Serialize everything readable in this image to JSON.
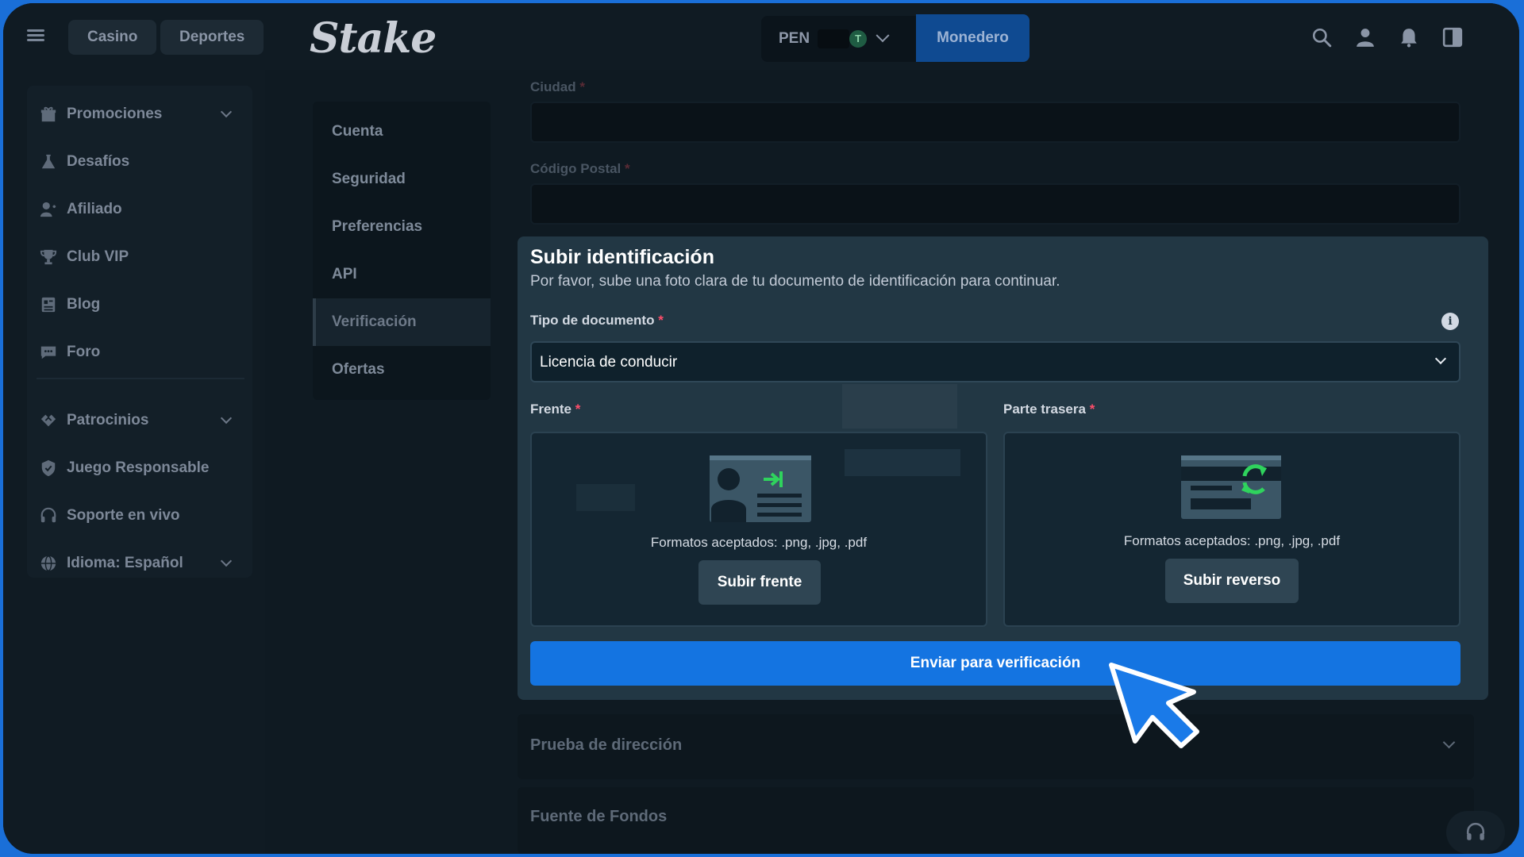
{
  "topbar": {
    "tabs": [
      "Casino",
      "Deportes"
    ],
    "logo": "Stake",
    "currency": "PEN",
    "currency_badge": "T",
    "wallet_label": "Monedero",
    "icons": [
      "search-icon",
      "user-icon",
      "bell-icon",
      "sidebar-toggle-icon"
    ]
  },
  "sidebar": {
    "items": [
      {
        "label": "Promociones",
        "icon": "gift-icon",
        "expandable": true
      },
      {
        "label": "Desafíos",
        "icon": "flask-icon",
        "expandable": false
      },
      {
        "label": "Afiliado",
        "icon": "affiliate-icon",
        "expandable": false
      },
      {
        "label": "Club VIP",
        "icon": "trophy-icon",
        "expandable": false
      },
      {
        "label": "Blog",
        "icon": "blog-icon",
        "expandable": false
      },
      {
        "label": "Foro",
        "icon": "forum-icon",
        "expandable": false
      },
      {
        "label": "Patrocinios",
        "icon": "handshake-icon",
        "expandable": true
      },
      {
        "label": "Juego Responsable",
        "icon": "shield-icon",
        "expandable": false
      },
      {
        "label": "Soporte en vivo",
        "icon": "headset-icon",
        "expandable": false
      },
      {
        "label": "Idioma: Español",
        "icon": "globe-icon",
        "expandable": true
      }
    ]
  },
  "settings_nav": {
    "items": [
      "Cuenta",
      "Seguridad",
      "Preferencias",
      "API",
      "Verificación",
      "Ofertas"
    ],
    "active": "Verificación"
  },
  "background_form": {
    "city_label": "Ciudad",
    "postal_label": "Código Postal",
    "required_mark": "*",
    "sections": [
      "Prueba de dirección",
      "Fuente de Fondos"
    ]
  },
  "modal": {
    "title": "Subir identificación",
    "subtitle": "Por favor, sube una foto clara de tu documento de identificación para continuar.",
    "doc_type_label": "Tipo de documento",
    "doc_type_value": "Licencia de conducir",
    "required_mark": "*",
    "front": {
      "label": "Frente",
      "formats": "Formatos aceptados: .png, .jpg, .pdf",
      "button": "Subir frente"
    },
    "back": {
      "label": "Parte trasera",
      "formats": "Formatos aceptados: .png, .jpg, .pdf",
      "button": "Subir reverso"
    },
    "submit_label": "Enviar para verificación"
  },
  "colors": {
    "frame_border": "#1a6fd8",
    "primary_button": "#1474e1",
    "required": "#ff4d6a",
    "icon_green": "#2fd35d"
  }
}
